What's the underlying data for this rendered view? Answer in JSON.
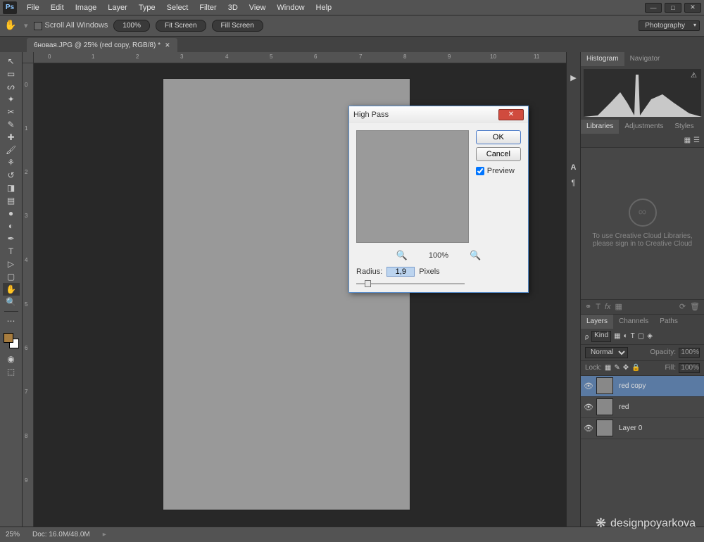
{
  "menubar": {
    "items": [
      "File",
      "Edit",
      "Image",
      "Layer",
      "Type",
      "Select",
      "Filter",
      "3D",
      "View",
      "Window",
      "Help"
    ]
  },
  "options": {
    "scroll_label": "Scroll All Windows",
    "zoom_pct": "100%",
    "fit": "Fit Screen",
    "fill": "Fill Screen",
    "workspace": "Photography"
  },
  "doc_tab": {
    "title": "6новая.JPG @ 25% (red copy, RGB/8) *"
  },
  "ruler_h": [
    "0",
    "1",
    "2",
    "3",
    "4",
    "5",
    "6",
    "7",
    "8",
    "9",
    "10",
    "11"
  ],
  "ruler_v": [
    "0",
    "1",
    "2",
    "3",
    "4",
    "5",
    "6",
    "7",
    "8",
    "9"
  ],
  "panels": {
    "histogram_tabs": [
      "Histogram",
      "Navigator"
    ],
    "lib_tabs": [
      "Libraries",
      "Adjustments",
      "Styles"
    ],
    "cc_msg1": "To use Creative Cloud Libraries,",
    "cc_msg2": "please sign in to Creative Cloud",
    "layer_tabs": [
      "Layers",
      "Channels",
      "Paths"
    ],
    "kind": "Kind",
    "blend": "Normal",
    "opacity_lbl": "Opacity:",
    "opacity_val": "100%",
    "lock_lbl": "Lock:",
    "fill_lbl": "Fill:",
    "fill_val": "100%",
    "layers": [
      {
        "name": "red copy",
        "active": true
      },
      {
        "name": "red",
        "active": false
      },
      {
        "name": "Layer 0",
        "active": false
      }
    ]
  },
  "dialog": {
    "title": "High Pass",
    "ok": "OK",
    "cancel": "Cancel",
    "preview": "Preview",
    "zoom": "100%",
    "radius_lbl": "Radius:",
    "radius_val": "1,9",
    "radius_unit": "Pixels"
  },
  "status": {
    "zoom": "25%",
    "doc": "Doc: 16.0M/48.0M"
  },
  "watermark": "designpoyarkova"
}
